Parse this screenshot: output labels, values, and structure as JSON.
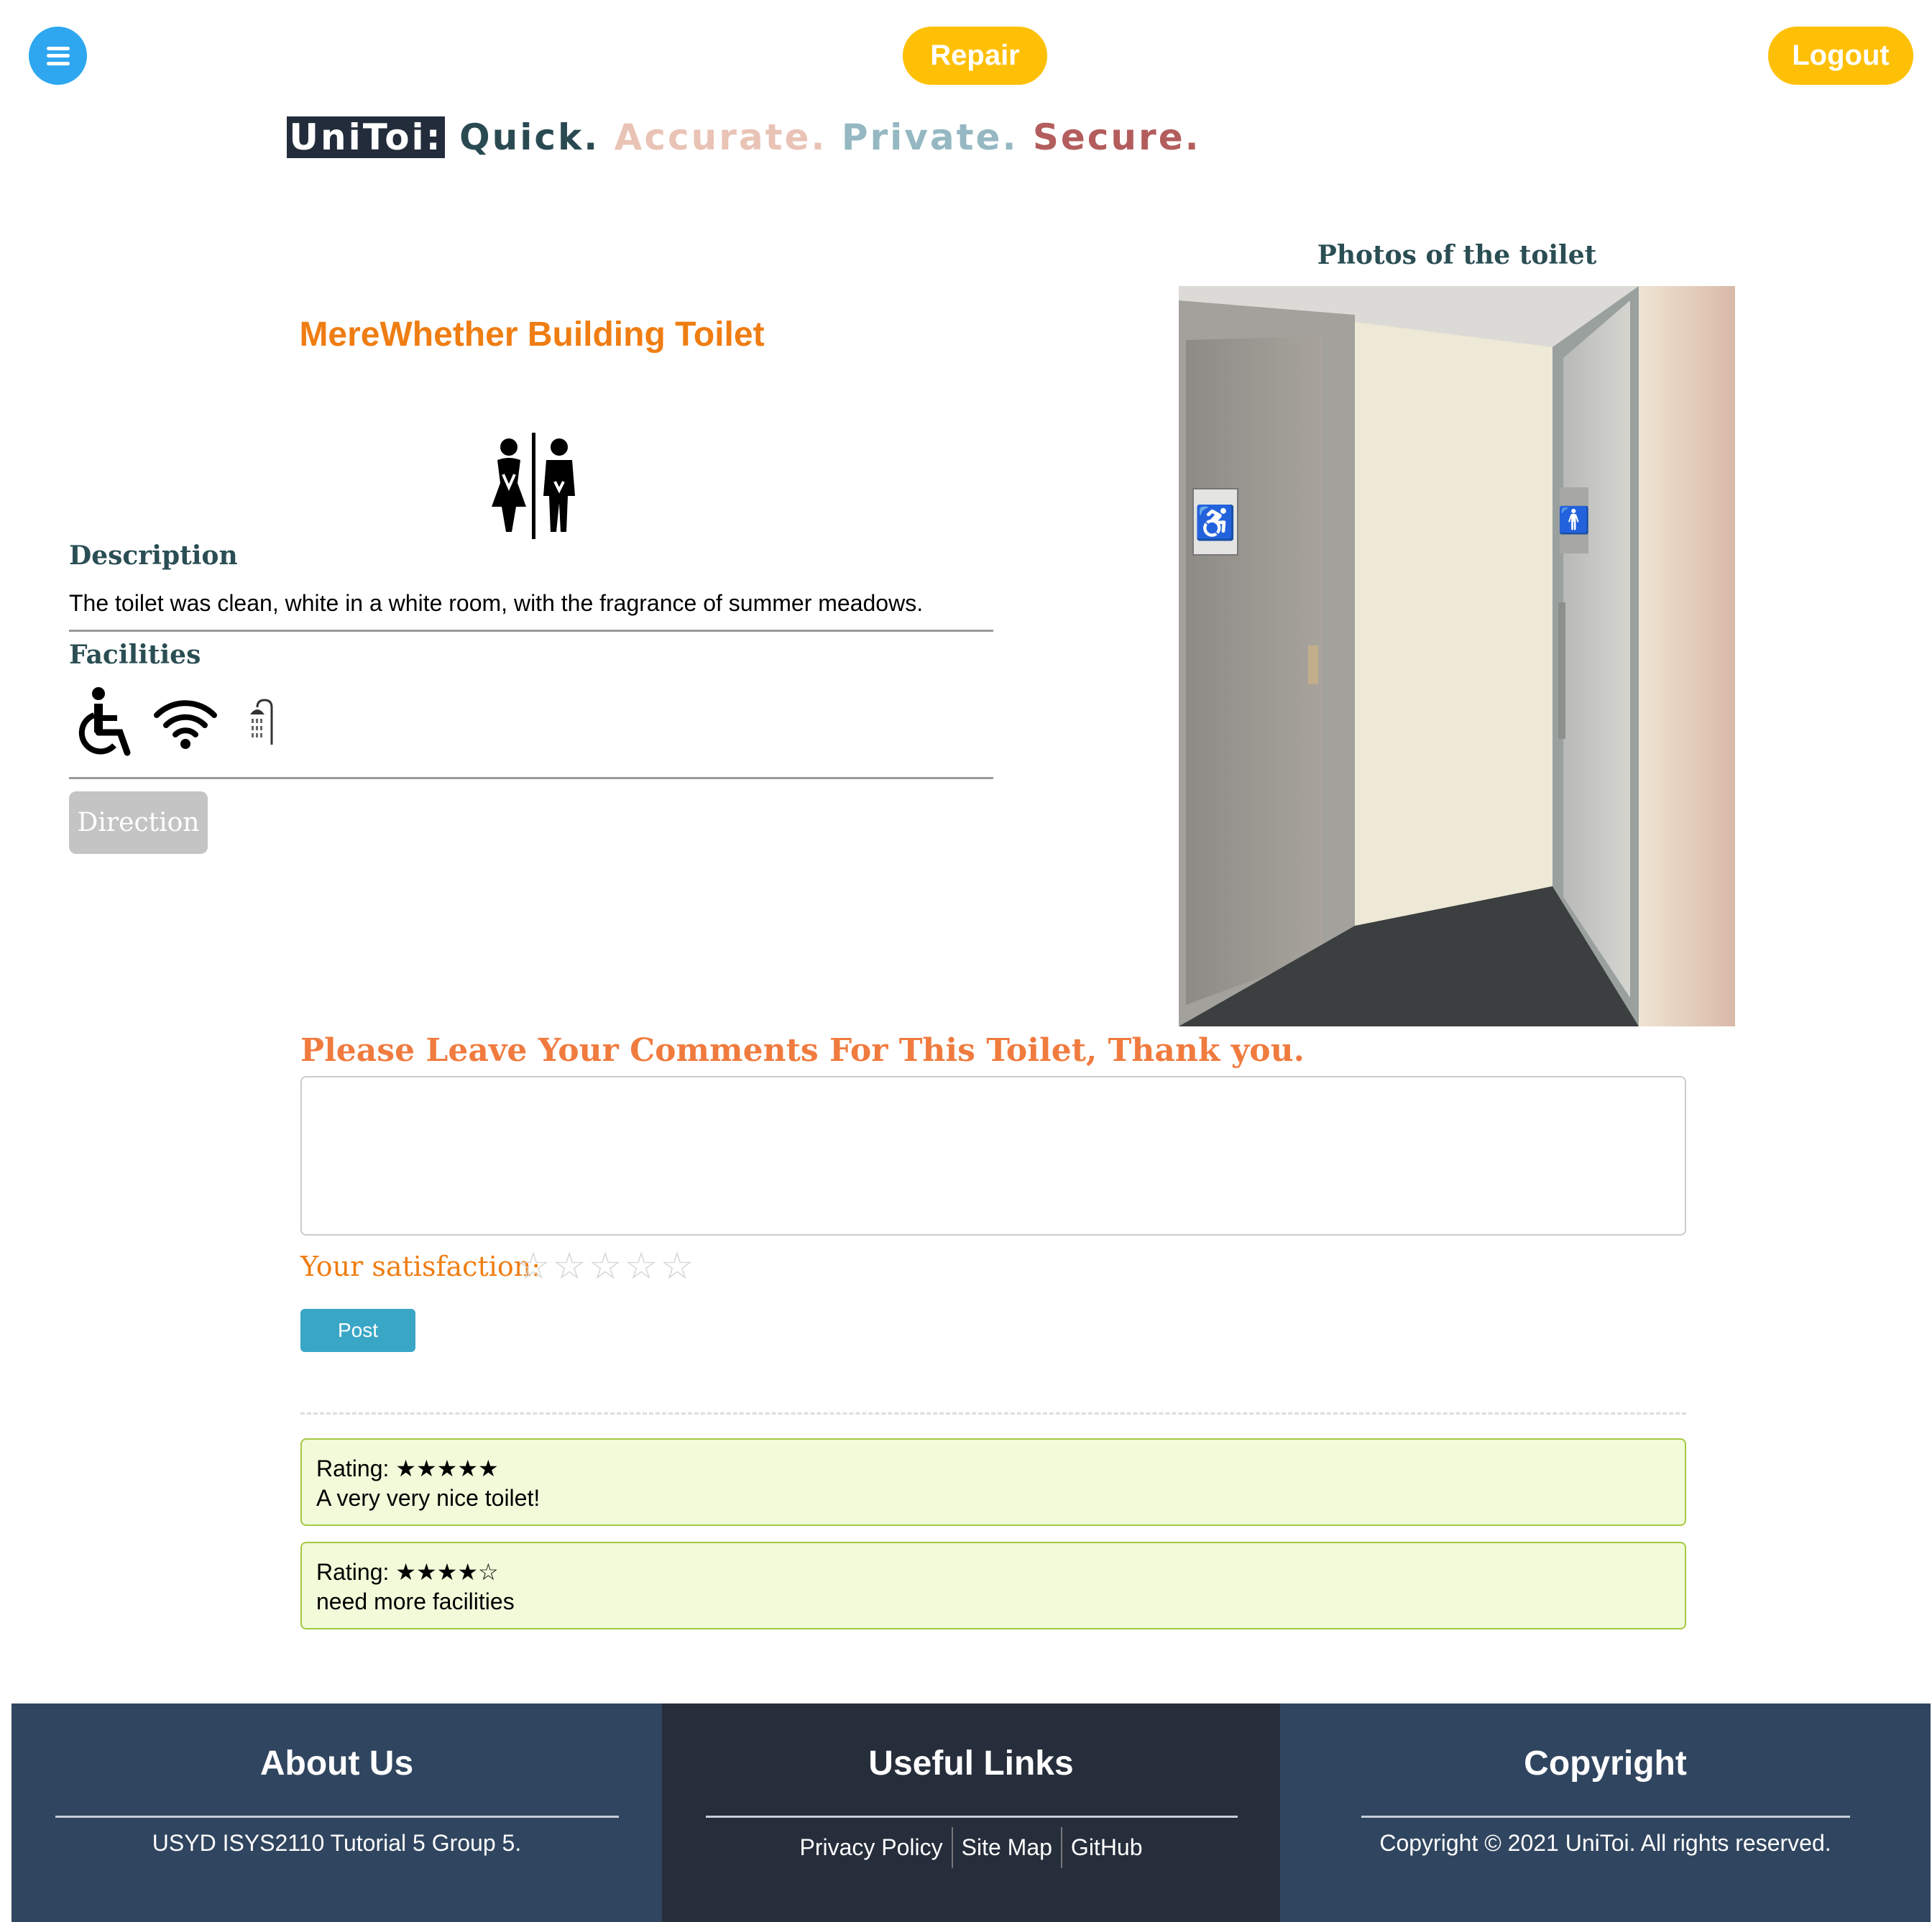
{
  "header": {
    "repair_label": "Repair",
    "logout_label": "Logout",
    "menu_icon": "hamburger-icon"
  },
  "tagline": {
    "brand": "UniToi:",
    "words": [
      "Quick.",
      "Accurate.",
      "Private.",
      "Secure."
    ],
    "colors": [
      "#2a4a52",
      "#e9c3b5",
      "#95b8c2",
      "#b35d5d"
    ]
  },
  "toilet": {
    "title": "MereWhether Building Toilet",
    "gender_icon": "unisex-toilet-icon",
    "description_heading": "Description",
    "description": "The toilet was clean, white in a white room, with the fragrance of summer meadows.",
    "facilities_heading": "Facilities",
    "facilities": [
      "wheelchair-icon",
      "wifi-icon",
      "shower-icon"
    ],
    "direction_label": "Direction"
  },
  "photos": {
    "caption": "Photos of the toilet"
  },
  "comment_form": {
    "heading": "Please Leave Your Comments For This Toilet, Thank you.",
    "textarea_value": "",
    "satisfaction_label": "Your satisfaction:",
    "stars": [
      "☆",
      "☆",
      "☆",
      "☆",
      "☆"
    ],
    "post_label": "Post"
  },
  "reviews": [
    {
      "rating_label": "Rating: ★★★★★",
      "text": "A very very nice toilet!"
    },
    {
      "rating_label": "Rating: ★★★★☆",
      "text": "need more facilities"
    }
  ],
  "footer": {
    "about_heading": "About Us",
    "about_text": "USYD ISYS2110 Tutorial 5 Group 5.",
    "links_heading": "Useful Links",
    "links": [
      "Privacy Policy",
      "Site Map",
      "GitHub"
    ],
    "copyright_heading": "Copyright",
    "copyright_text": "Copyright © 2021 UniToi. All rights reserved."
  },
  "colors": {
    "accent_blue": "#2ea7f0",
    "pill_yellow": "#fec007",
    "title_orange": "#ef7d12",
    "post_teal": "#3aa6c6",
    "footer_navy": "#30455f",
    "footer_dark": "#262d3b"
  }
}
